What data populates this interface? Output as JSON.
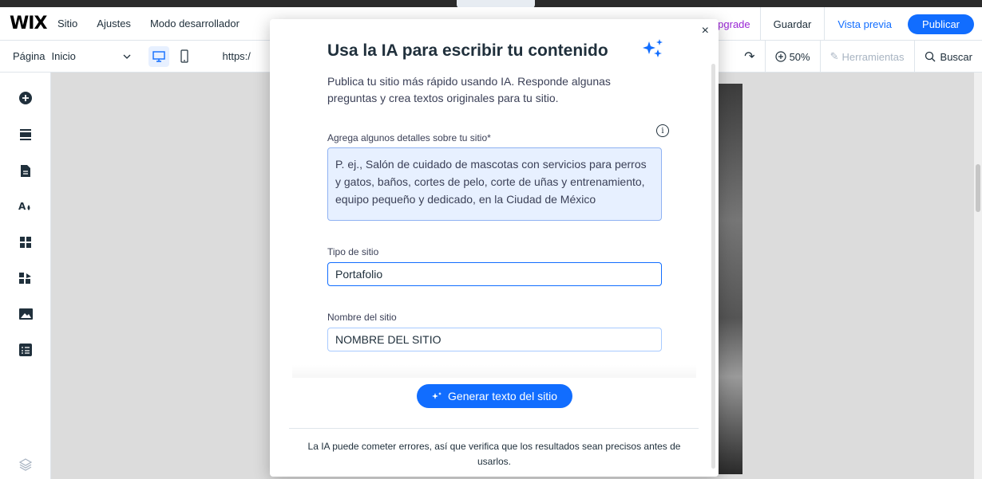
{
  "topbar": {
    "logo": "WIX",
    "menu": [
      "Sitio",
      "Ajustes",
      "Modo desarrollador"
    ],
    "upgrade": "z Upgrade",
    "save": "Guardar",
    "preview": "Vista previa",
    "publish": "Publicar"
  },
  "secondbar": {
    "page_label": "Página",
    "page_value": "Inicio",
    "url": "https:/",
    "zoom": "50%",
    "tools": "Herramientas",
    "search": "Buscar"
  },
  "modal": {
    "title": "Usa la IA para escribir tu contenido",
    "subtitle": "Publica tu sitio más rápido usando IA. Responde algunas preguntas y crea textos originales para tu sitio.",
    "details_label": "Agrega algunos detalles sobre tu sitio*",
    "details_placeholder": "P. ej., Salón de cuidado de mascotas con servicios para perros y gatos, baños, cortes de pelo, corte de uñas y entrenamiento, equipo pequeño y dedicado, en la Ciudad de México",
    "site_type_label": "Tipo de sitio",
    "site_type_value": "Portafolio",
    "site_name_label": "Nombre del sitio",
    "site_name_value": "NOMBRE DEL SITIO",
    "generate_button": "Generar texto del sitio",
    "disclaimer": "La IA puede cometer errores, así que verifica que los resultados sean precisos antes de usarlos.",
    "close_icon": "×"
  },
  "colors": {
    "accent": "#116dff",
    "upgrade": "#9a27d5",
    "field_bg": "#e7f0ff"
  }
}
